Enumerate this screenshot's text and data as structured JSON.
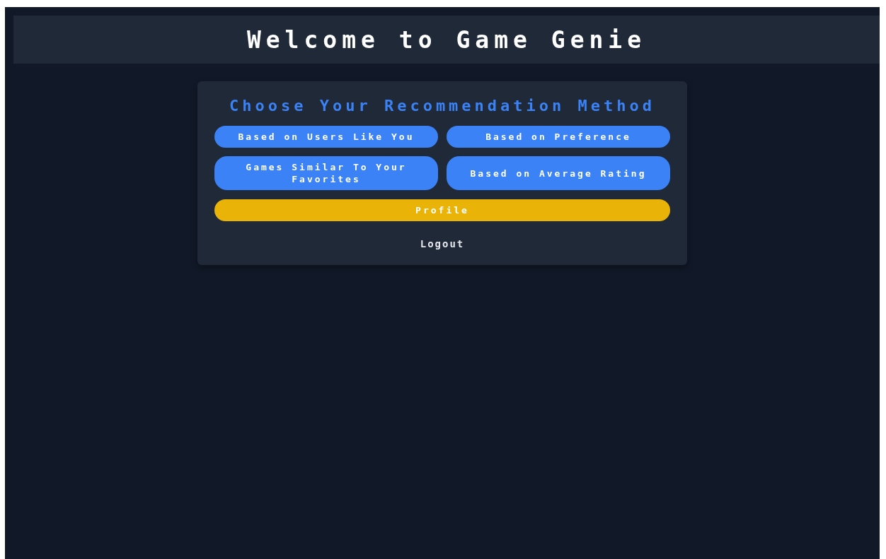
{
  "header": {
    "title": "Welcome to Game Genie"
  },
  "card": {
    "title": "Choose Your Recommendation Method",
    "methods": [
      {
        "label": "Based on Users Like You"
      },
      {
        "label": "Based on Preference"
      },
      {
        "label": "Games Similar To Your Favorites"
      },
      {
        "label": "Based on Average Rating"
      }
    ],
    "profile_button": "Profile",
    "logout_link": "Logout"
  }
}
